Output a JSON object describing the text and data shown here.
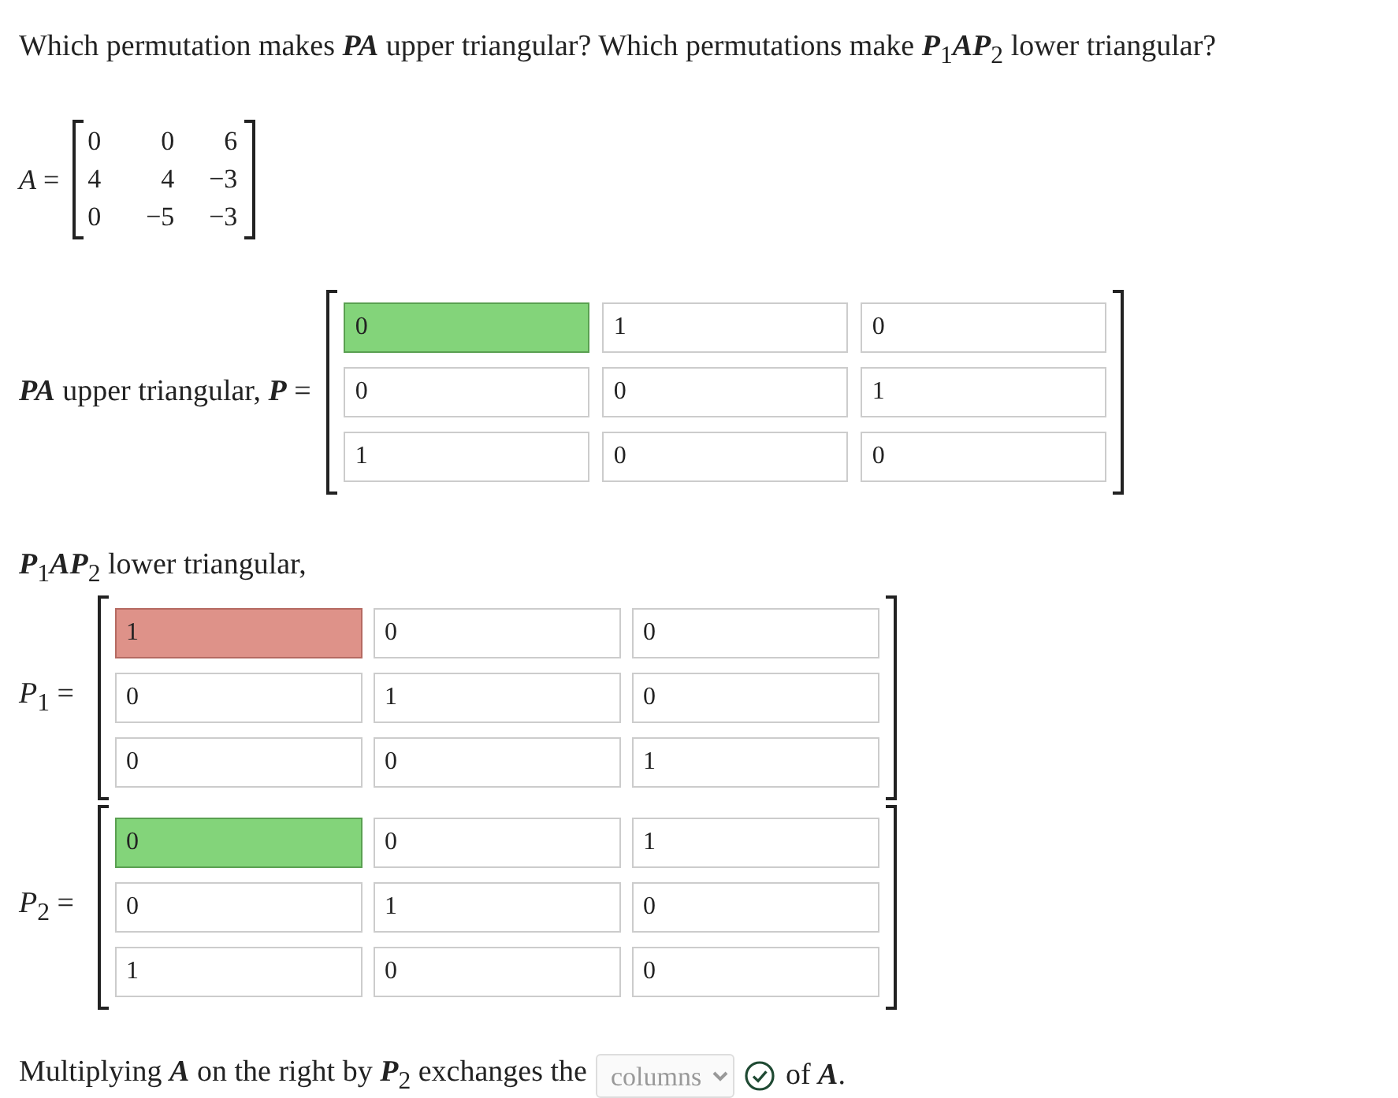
{
  "question": "Which permutation makes **PA** upper triangular? Which permutations make **P**$_{1}$**AP**$_{2}$ lower triangular?",
  "matrix_a": {
    "label": "*A* =",
    "rows": [
      [
        "0",
        "0",
        "6"
      ],
      [
        "4",
        "4",
        "−3"
      ],
      [
        "0",
        "−5",
        "−3"
      ]
    ]
  },
  "part_1": {
    "label": "**PA** upper triangular, **P** =",
    "matrices": [
      {
        "rows": [
          [
            {
              "value": "0",
              "correct": true,
              "incorrect": false
            },
            {
              "value": "1",
              "correct": false,
              "incorrect": false
            },
            {
              "value": "0",
              "correct": false,
              "incorrect": false
            }
          ],
          [
            {
              "value": "0",
              "correct": false,
              "incorrect": false
            },
            {
              "value": "0",
              "correct": false,
              "incorrect": false
            },
            {
              "value": "1",
              "correct": false,
              "incorrect": false
            }
          ],
          [
            {
              "value": "1",
              "correct": false,
              "incorrect": false
            },
            {
              "value": "0",
              "correct": false,
              "incorrect": false
            },
            {
              "value": "0",
              "correct": false,
              "incorrect": false
            }
          ]
        ]
      }
    ]
  },
  "part_2": {
    "heading": "**P**$_{1}$**AP**$_{2}$ lower triangular,",
    "matrices": [
      {
        "label": "*P*$_{1}$ =",
        "rows": [
          [
            {
              "value": "1",
              "correct": false,
              "incorrect": true
            },
            {
              "value": "0",
              "correct": false,
              "incorrect": false
            },
            {
              "value": "0",
              "correct": false,
              "incorrect": false
            }
          ],
          [
            {
              "value": "0",
              "correct": false,
              "incorrect": false
            },
            {
              "value": "1",
              "correct": false,
              "incorrect": false
            },
            {
              "value": "0",
              "correct": false,
              "incorrect": false
            }
          ],
          [
            {
              "value": "0",
              "correct": false,
              "incorrect": false
            },
            {
              "value": "0",
              "correct": false,
              "incorrect": false
            },
            {
              "value": "1",
              "correct": false,
              "incorrect": false
            }
          ]
        ]
      },
      {
        "label": "*P*$_{2}$ =",
        "rows": [
          [
            {
              "value": "0",
              "correct": true,
              "incorrect": false
            },
            {
              "value": "0",
              "correct": false,
              "incorrect": false
            },
            {
              "value": "1",
              "correct": false,
              "incorrect": false
            }
          ],
          [
            {
              "value": "0",
              "correct": false,
              "incorrect": false
            },
            {
              "value": "1",
              "correct": false,
              "incorrect": false
            },
            {
              "value": "0",
              "correct": false,
              "incorrect": false
            }
          ],
          [
            {
              "value": "1",
              "correct": false,
              "incorrect": false
            },
            {
              "value": "0",
              "correct": false,
              "incorrect": false
            },
            {
              "value": "0",
              "correct": false,
              "incorrect": false
            }
          ]
        ]
      }
    ]
  },
  "final_sentence": {
    "before": "Multiplying **A** on the right by **P**$_{2}$ exchanges the",
    "dropdown": {
      "value": "columns",
      "correct": true
    },
    "after": "of **A**."
  }
}
